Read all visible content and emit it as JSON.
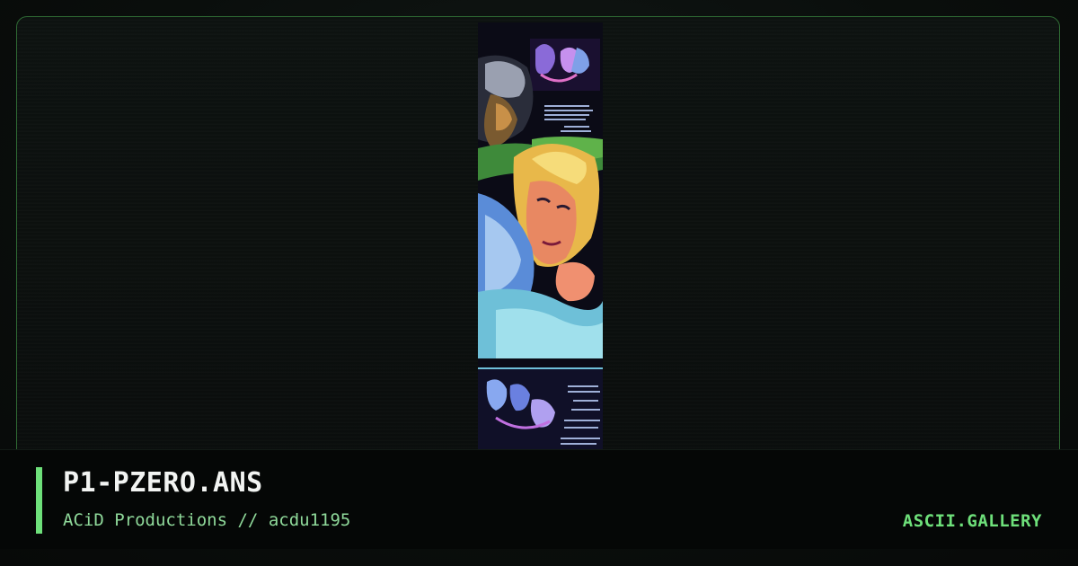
{
  "artwork": {
    "filename": "P1-PZERO.ANS",
    "group": "ACiD Productions",
    "separator": "//",
    "pack": "acdu1195"
  },
  "site": {
    "name": "ASCII.GALLERY"
  },
  "colors": {
    "background": "#0b0f0d",
    "frame_border": "#2f6b34",
    "accent": "#6ee07a",
    "subtitle": "#8fd99a",
    "title": "#f2f4f2"
  },
  "icons": {
    "artwork_preview": "ansi-art-thumbnail"
  }
}
